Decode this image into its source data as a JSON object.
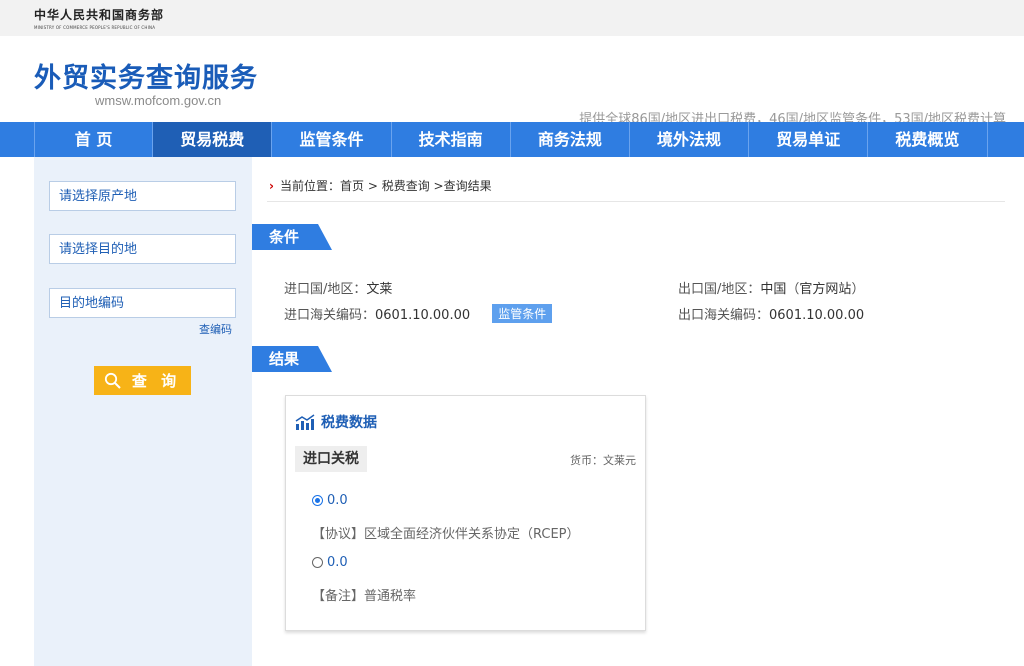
{
  "ministry": {
    "name_cn": "中华人民共和国商务部",
    "name_en": "MINISTRY OF COMMERCE PEOPLE'S REPUBLIC OF CHINA"
  },
  "header": {
    "title": "外贸实务查询服务",
    "url": "wmsw.mofcom.gov.cn",
    "tagline": "提供全球86国/地区进出口税费，46国/地区监管条件，53国/地区税费计算"
  },
  "nav": {
    "items": [
      {
        "label": "首 页"
      },
      {
        "label": "贸易税费"
      },
      {
        "label": "监管条件"
      },
      {
        "label": "技术指南"
      },
      {
        "label": "商务法规"
      },
      {
        "label": "境外法规"
      },
      {
        "label": "贸易单证"
      },
      {
        "label": "税费概览"
      }
    ],
    "active": "贸易税费"
  },
  "sidebar": {
    "origin_placeholder": "请选择原产地",
    "dest_placeholder": "请选择目的地",
    "code_placeholder": "目的地编码",
    "code_link": "查编码",
    "query_button": "查 询"
  },
  "breadcrumb": {
    "prefix": "当前位置：",
    "items": [
      "首页",
      "税费查询",
      "查询结果"
    ],
    "sep": ">"
  },
  "conditions": {
    "section_label": "条件",
    "import_country_label": "进口国/地区：",
    "import_country": "文莱",
    "import_code_label": "进口海关编码：",
    "import_code": "0601.10.00.00",
    "regulation_badge": "监管条件",
    "export_country_label": "出口国/地区：",
    "export_country": "中国",
    "official_site": "官方网站",
    "export_code_label": "出口海关编码：",
    "export_code": "0601.10.00.00"
  },
  "results": {
    "section_label": "结果",
    "card_title": "税费数据",
    "tax_type": "进口关税",
    "currency": "货币：文莱元",
    "options": [
      {
        "value": "0.0",
        "selected": true,
        "note": "【协议】区域全面经济伙伴关系协定（RCEP）"
      },
      {
        "value": "0.0",
        "selected": false,
        "note": "【备注】普通税率"
      }
    ]
  },
  "colors": {
    "primary": "#2f7de1",
    "active_nav": "#1f5fb5",
    "title": "#1a5cb8",
    "button": "#f7b317",
    "sidebar_bg": "#eaf1fa"
  }
}
